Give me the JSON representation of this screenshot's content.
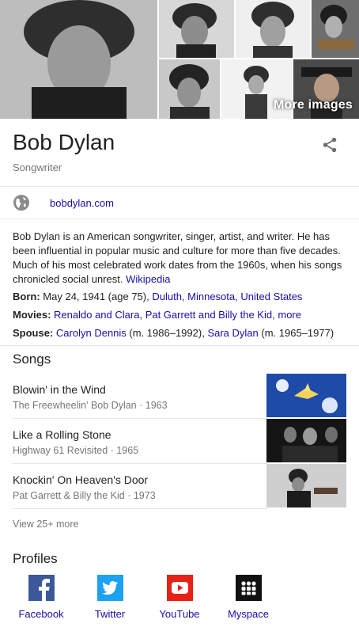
{
  "images": {
    "more_label": "More images"
  },
  "header": {
    "title": "Bob Dylan",
    "subtitle": "Songwriter"
  },
  "website": {
    "label": "bobdylan.com"
  },
  "description": {
    "text": "Bob Dylan is an American songwriter, singer, artist, and writer. He has been influential in popular music and culture for more than five decades. Much of his most celebrated work dates from the 1960s, when his songs chronicled social unrest.",
    "source": "Wikipedia"
  },
  "facts": {
    "born": {
      "label": "Born:",
      "value": "May 24, 1941 (age 75),",
      "link1": "Duluth, Minnesota,",
      "link2": "United States"
    },
    "movies": {
      "label": "Movies:",
      "link1": "Renaldo and Clara",
      "sep1": ",",
      "link2": "Pat Garrett and Billy the Kid",
      "sep2": ",",
      "more": "more"
    },
    "spouse": {
      "label": "Spouse:",
      "link1": "Carolyn Dennis",
      "value1": "(m. 1986–1992),",
      "link2": "Sara Dylan",
      "value2": "(m. 1965–1977)"
    }
  },
  "songs": {
    "heading": "Songs",
    "items": [
      {
        "title": "Blowin' in the Wind",
        "meta": "The Freewheelin' Bob Dylan · 1963"
      },
      {
        "title": "Like a Rolling Stone",
        "meta": "Highway 61 Revisited · 1965"
      },
      {
        "title": "Knockin' On Heaven's Door",
        "meta": "Pat Garrett & Billy the Kid · 1973"
      }
    ],
    "view_more": "View 25+ more"
  },
  "profiles": {
    "heading": "Profiles",
    "items": [
      {
        "label": "Facebook",
        "icon": "facebook-icon",
        "color": "#3b5998"
      },
      {
        "label": "Twitter",
        "icon": "twitter-icon",
        "color": "#1da1f2"
      },
      {
        "label": "YouTube",
        "icon": "youtube-icon",
        "color": "#e62117"
      },
      {
        "label": "Myspace",
        "icon": "myspace-icon",
        "color": "#111111"
      }
    ]
  },
  "colors": {
    "link": "#1a0dab",
    "muted": "#777777",
    "divider": "#e6e6e6"
  }
}
